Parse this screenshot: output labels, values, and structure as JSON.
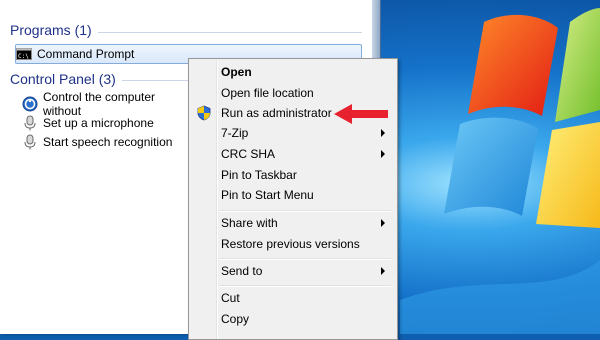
{
  "start_menu": {
    "programs_heading": "Programs (1)",
    "programs": [
      {
        "label": "Command Prompt",
        "icon": "cmd-icon"
      }
    ],
    "control_panel_heading": "Control Panel (3)",
    "control_panel": [
      {
        "label": "Control the computer without",
        "icon": "ease-of-access-icon"
      },
      {
        "label": "Set up a microphone",
        "icon": "microphone-icon"
      },
      {
        "label": "Start speech recognition",
        "icon": "microphone-icon"
      }
    ]
  },
  "context_menu": {
    "items": [
      {
        "label": "Open",
        "bold": true
      },
      {
        "label": "Open file location"
      },
      {
        "label": "Run as administrator",
        "icon": "uac-shield-icon"
      },
      {
        "label": "7-Zip",
        "submenu": true
      },
      {
        "label": "CRC SHA",
        "submenu": true
      },
      {
        "label": "Pin to Taskbar"
      },
      {
        "label": "Pin to Start Menu"
      },
      {
        "label": "Share with",
        "submenu": true
      },
      {
        "label": "Restore previous versions"
      },
      {
        "label": "Send to",
        "submenu": true
      },
      {
        "label": "Cut"
      },
      {
        "label": "Copy"
      }
    ]
  },
  "colors": {
    "heading": "#1e3287",
    "arrow_annotation": "#e8212f"
  }
}
